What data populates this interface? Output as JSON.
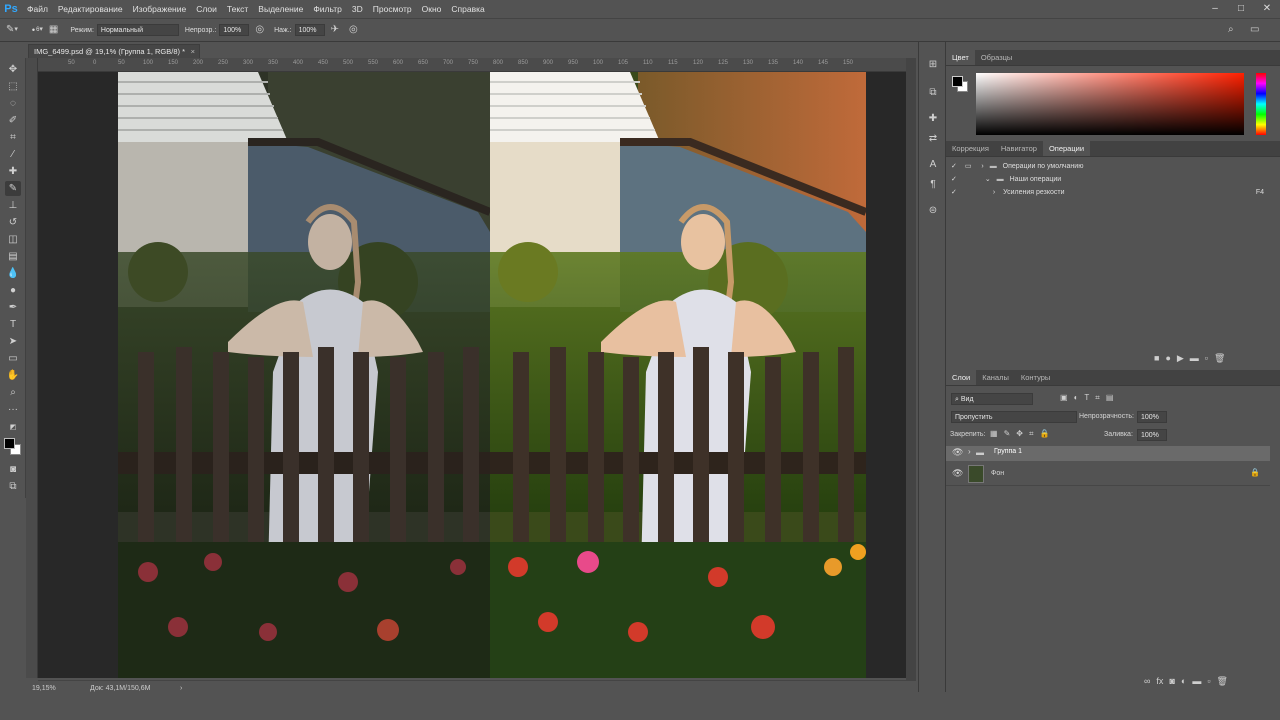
{
  "app": {
    "logo": "Ps"
  },
  "menu": [
    "Файл",
    "Редактирование",
    "Изображение",
    "Слои",
    "Текст",
    "Выделение",
    "Фильтр",
    "3D",
    "Просмотр",
    "Окно",
    "Справка"
  ],
  "window_controls": [
    "–",
    "□",
    "✕"
  ],
  "options": {
    "brush_size": "6",
    "mode_label": "Режим:",
    "mode_value": "Нормальный",
    "opacity_label": "Непрозр.:",
    "opacity_value": "100%",
    "pressure_label": "Наж.:",
    "pressure_value": "100%"
  },
  "document_tab": {
    "title": "IMG_6499.psd @ 19,1% (Группа 1, RGB/8) *",
    "close": "×"
  },
  "ruler_h": [
    "50",
    "0",
    "50",
    "100",
    "150",
    "200",
    "250",
    "300",
    "350",
    "400",
    "450",
    "500",
    "550",
    "600",
    "650",
    "700",
    "750",
    "800",
    "850",
    "900",
    "950",
    "100",
    "105",
    "110",
    "115",
    "120",
    "125",
    "130",
    "135",
    "140",
    "145",
    "150"
  ],
  "status": {
    "zoom": "19,15%",
    "doc": "Док: 43,1M/150,6M",
    "arrow": "›"
  },
  "color_panel": {
    "tabs": [
      "Цвет",
      "Образцы"
    ],
    "fg": "#000000",
    "bg": "#ffffff",
    "hue": "#ff2000"
  },
  "actions_panel": {
    "tabs": [
      "Коррекция",
      "Навигатор",
      "Операции"
    ],
    "rows": [
      {
        "label": "Операции по умолчанию",
        "key": ""
      },
      {
        "label": "Наши операции",
        "key": ""
      },
      {
        "label": "Усиления резкости",
        "key": "F4"
      }
    ]
  },
  "layers_panel": {
    "tabs": [
      "Слои",
      "Каналы",
      "Контуры"
    ],
    "filter": "Вид",
    "blend": "Пропустить",
    "opacity_label": "Непрозрачность:",
    "opacity_value": "100%",
    "lock_label": "Закрепить:",
    "fill_label": "Заливка:",
    "fill_value": "100%",
    "layers": [
      {
        "name": "Группа 1",
        "type": "group"
      },
      {
        "name": "Фон",
        "type": "image"
      }
    ],
    "footer_icons": [
      "link-icon",
      "fx-icon",
      "mask-icon",
      "adjustment-icon",
      "folder-icon",
      "new-layer-icon",
      "trash-icon"
    ]
  }
}
